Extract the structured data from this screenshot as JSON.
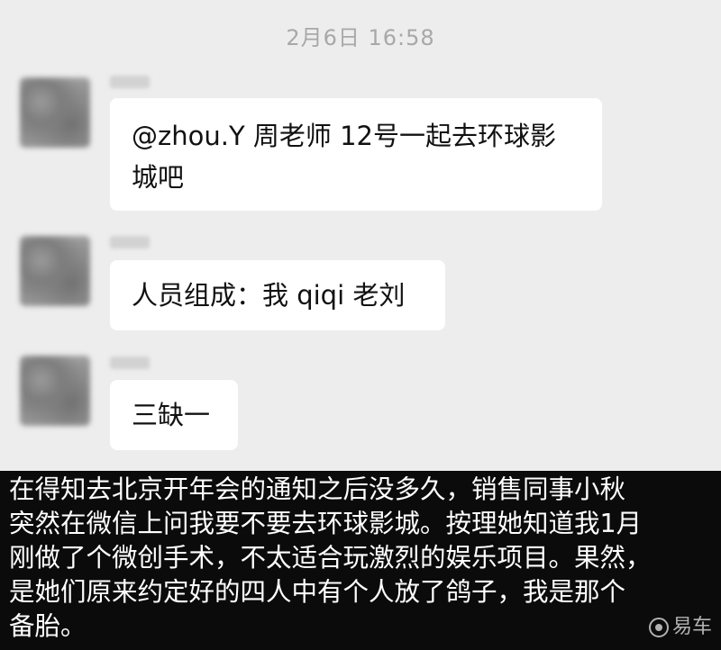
{
  "chat": {
    "timestamp": "2月6日 16:58",
    "messages": [
      {
        "text_line1": "@zhou.Y 周老师 12号一起去环球影",
        "text_line2": "城吧"
      },
      {
        "text_line1": "人员组成：我 qiqi 老刘"
      },
      {
        "text_line1": "三缺一"
      }
    ]
  },
  "caption": {
    "lines": [
      "在得知去北京开年会的通知之后没多久，销售同事小秋",
      "突然在微信上问我要不要去环球影城。按理她知道我1月",
      "刚做了个微创手术，不太适合玩激烈的娱乐项目。果然，",
      "是她们原来约定好的四人中有个人放了鸽子，我是那个",
      "备胎。"
    ]
  },
  "watermark": {
    "text": "易车",
    "icon": "yiche-logo-icon"
  },
  "colors": {
    "chat_bg": "#ededed",
    "bubble_bg": "#ffffff",
    "caption_bg": "#0b0b0b",
    "caption_text": "#ffffff"
  }
}
